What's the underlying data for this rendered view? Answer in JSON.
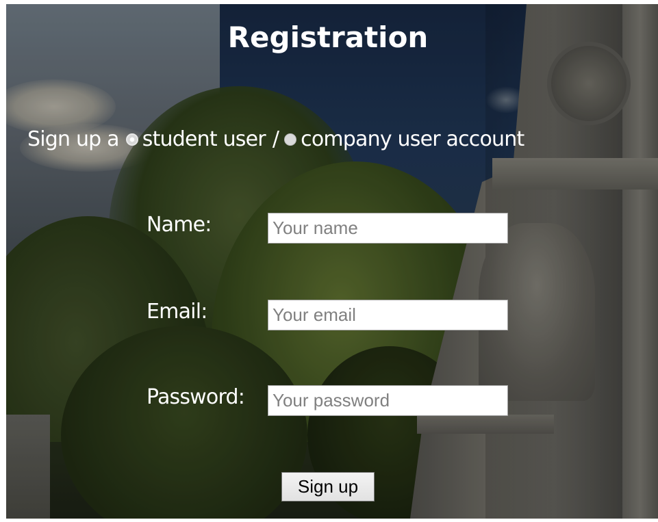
{
  "form": {
    "title": "Registration",
    "account_type": {
      "prefix": "Sign up a",
      "options": [
        {
          "label": "student user",
          "selected": true
        },
        {
          "label": "company user account",
          "selected": false
        }
      ],
      "separator": "/"
    },
    "fields": [
      {
        "label": "Name:",
        "placeholder": "Your name",
        "value": ""
      },
      {
        "label": "Email:",
        "placeholder": "Your email",
        "value": ""
      },
      {
        "label": "Password:",
        "placeholder": "Your password",
        "value": ""
      }
    ],
    "submit_label": "Sign up"
  }
}
